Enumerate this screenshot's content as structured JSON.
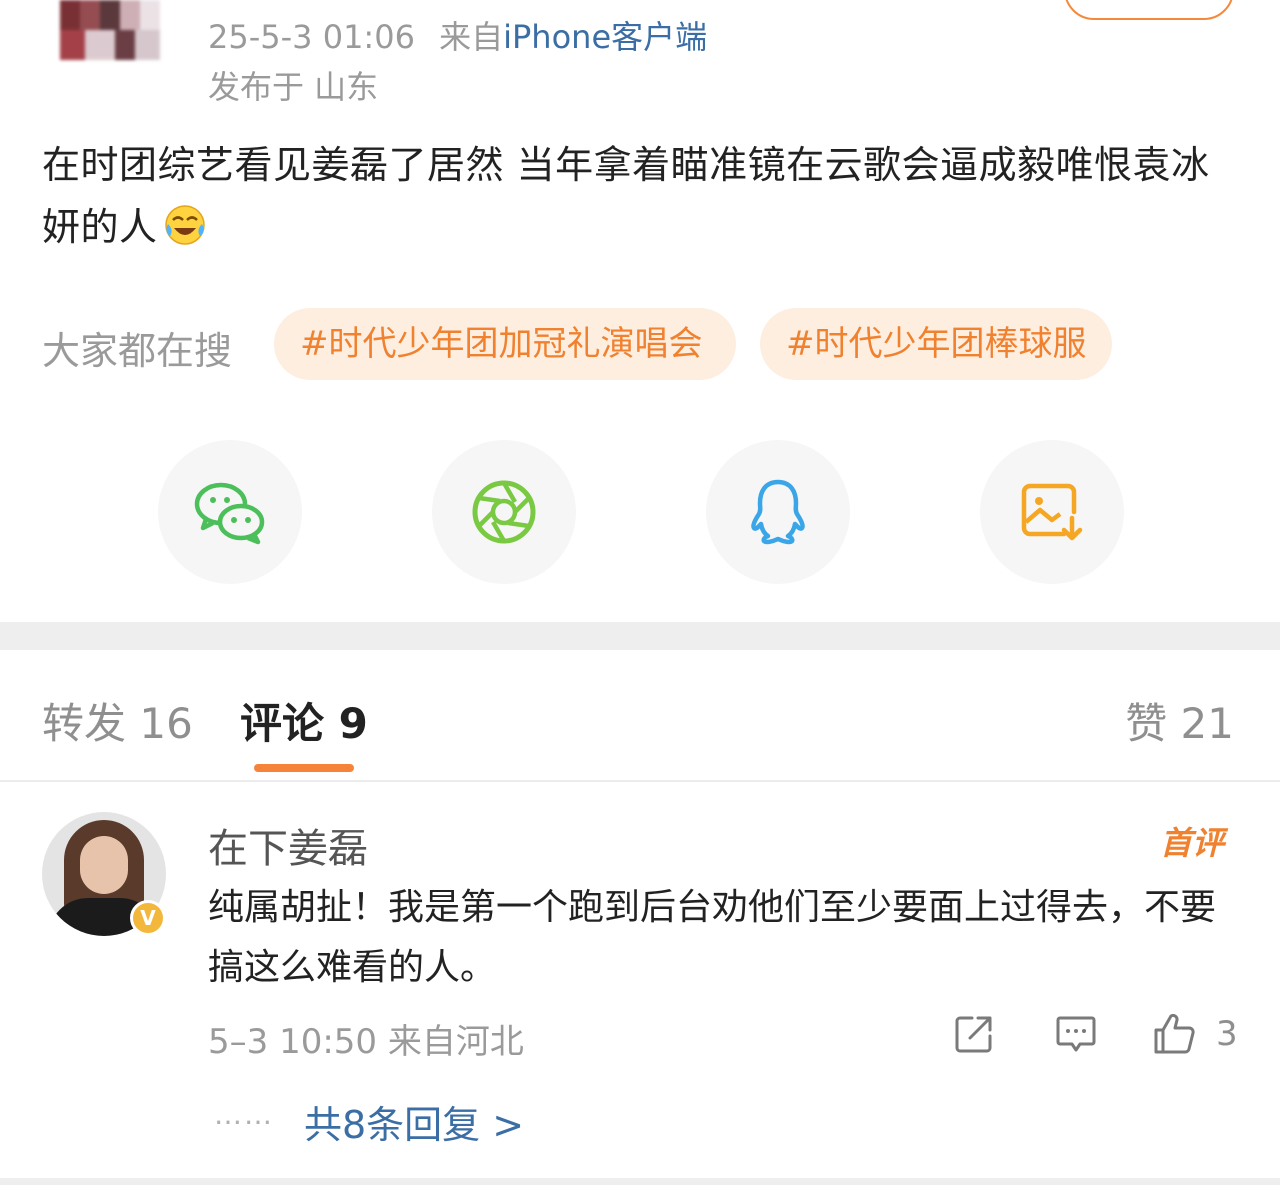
{
  "post": {
    "timestamp": "25-5-3 01:06",
    "source_prefix": "来自",
    "source_client": "iPhone客户端",
    "location": "发布于 山东",
    "text": "在时团综艺看见姜磊了居然 当年拿着瞄准镜在云歌会逼成毅唯恨袁冰妍的人"
  },
  "trending": {
    "label": "大家都在搜",
    "topics": [
      "#时代少年团加冠礼演唱会",
      "#时代少年团棒球服"
    ]
  },
  "share": {
    "icons": [
      "wechat-icon",
      "moments-icon",
      "qq-icon",
      "save-image-icon"
    ],
    "colors": {
      "wechat": "#4cbf5b",
      "moments": "#7ac943",
      "qq": "#3aa6e8",
      "save": "#f5a623"
    }
  },
  "tabs": {
    "repost": "转发 16",
    "comment": "评论 9",
    "like": "赞 21"
  },
  "comment": {
    "author": "在下姜磊",
    "badge": "首评",
    "verified": "V",
    "text": "纯属胡扯！我是第一个跑到后台劝他们至少要面上过得去，不要搞这么难看的人。",
    "meta": "5–3 10:50  来自河北",
    "like_count": "3",
    "replies_dots": "……",
    "replies_link": "共8条回复 >"
  },
  "colors": {
    "accent": "#f5833a",
    "link": "#3b6ea5",
    "chip_bg": "#fdeee0"
  }
}
